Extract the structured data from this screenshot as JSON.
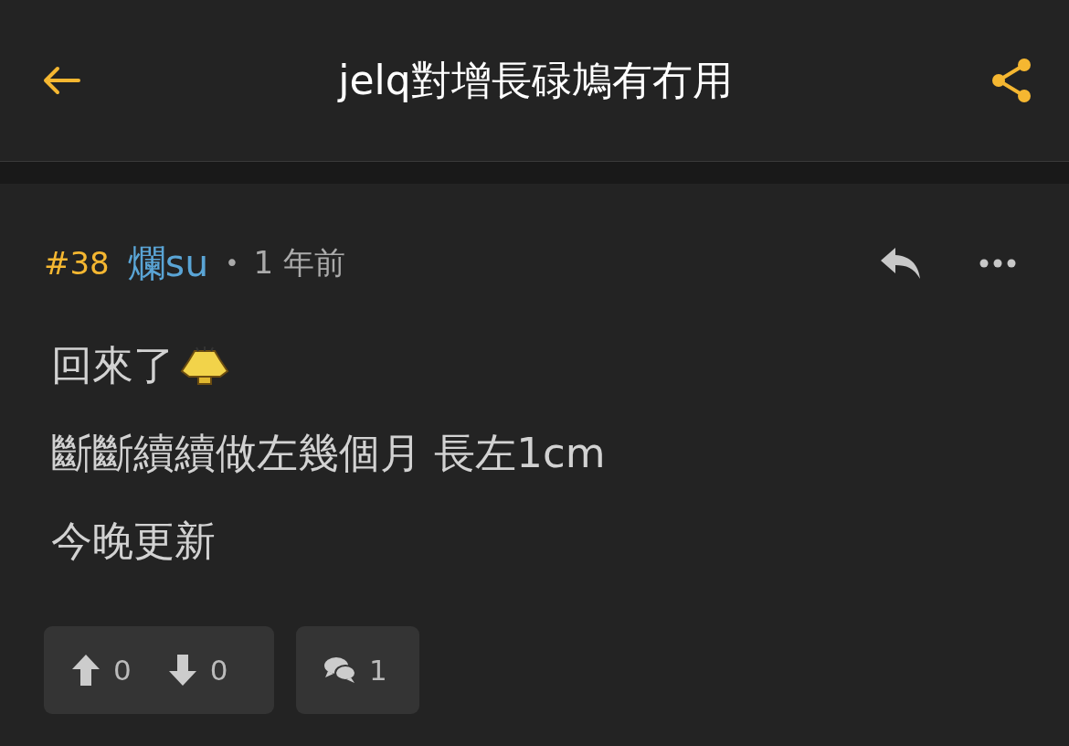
{
  "header": {
    "title": "jelq對增長碌鳩有冇用"
  },
  "post": {
    "number": "#38",
    "username": "爛su",
    "separator": "•",
    "time": "1 年前",
    "lines": [
      {
        "text": "回來了",
        "emoticon": true
      },
      {
        "text": "斷斷續續做左幾個月 長左1cm",
        "emoticon": false
      },
      {
        "text": "今晚更新",
        "emoticon": false
      }
    ],
    "upvotes": "0",
    "downvotes": "0",
    "comments": "1"
  }
}
